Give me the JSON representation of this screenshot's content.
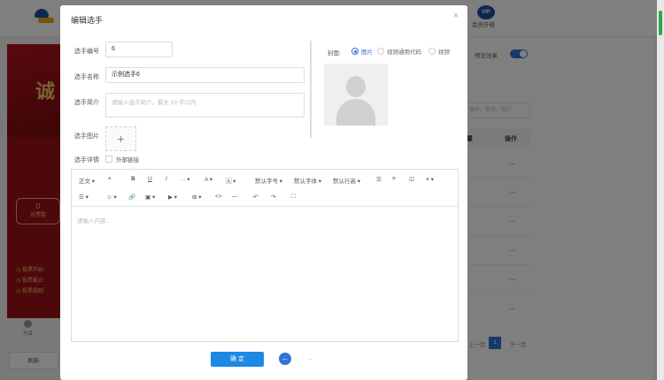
{
  "background": {
    "vip_label": "会员升级",
    "preview_label": "预览效果",
    "poster_text": "诚",
    "stat_value": "0",
    "stat_label": "总票数",
    "vote_lines": [
      "投票开始:",
      "投票截止:",
      "投票规则:"
    ],
    "share_label": "分享",
    "refresh_button": "刷新",
    "search_hint": "编号、名称、简介",
    "table_header_count": "量",
    "table_header_action": "操作",
    "row_action_icon": "···",
    "pager_prev": "上一页",
    "pager_current": "1",
    "pager_next": "下一页"
  },
  "modal": {
    "title": "编辑选手",
    "close_icon": "×",
    "fields": {
      "number_label": "选手编号",
      "number_value": "6",
      "name_label": "选手名称",
      "name_value": "示例选手6",
      "intro_label": "选手简介",
      "intro_placeholder": "请输入选手简介，最长 10 字以内",
      "image_label": "选手图片",
      "upload_plus": "+",
      "detail_label": "选手详情",
      "external_link_label": "外部链接"
    },
    "cover": {
      "label": "封面:",
      "options": [
        "图片",
        "视频通用代码",
        "视频"
      ],
      "selected": "图片"
    },
    "editor": {
      "toolbar_row1": [
        "正文 ▾",
        "❝",
        "B",
        "U",
        "I",
        "··· ▾",
        "A ▾",
        "🄰 ▾",
        "默认字号 ▾",
        "默认字体 ▾",
        "默认行高 ▾",
        "☰",
        "≡",
        "☑",
        "≡ ▾"
      ],
      "toolbar_row2": [
        "☰ ▾",
        "☺ ▾",
        "🔗",
        "▣ ▾",
        "▶ ▾",
        "⊞ ▾",
        "<>",
        "—",
        "↶",
        "↷",
        "⛶"
      ],
      "placeholder": "请输入内容..."
    },
    "confirm_button": "确 定",
    "nav_prev_icon": "←",
    "nav_next_icon": "→"
  }
}
